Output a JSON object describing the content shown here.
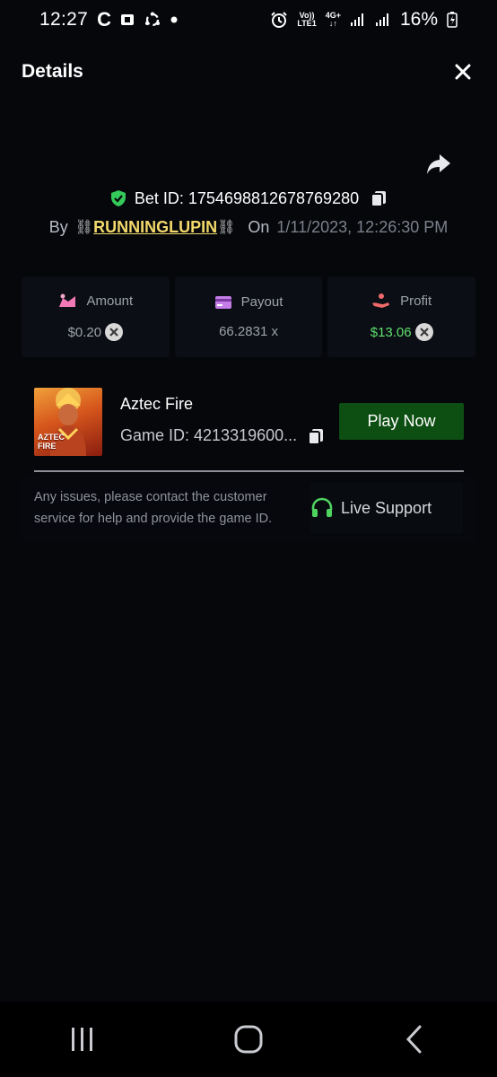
{
  "status_bar": {
    "time": "12:27",
    "carrier_icon": "C",
    "volte_top": "Vo))",
    "volte_bottom": "LTE1",
    "network_top": "4G+",
    "network_bottom": "↓↑",
    "battery_percent": "16%"
  },
  "header": {
    "title": "Details",
    "close_icon": "close-icon"
  },
  "bet": {
    "bet_id_label": "Bet ID: 1754698812678769280",
    "by_label": "By",
    "chain_left": "⛓",
    "username": "RUNNINGLUPIN",
    "chain_right": "⛓",
    "on_label": "On",
    "datetime": "1/11/2023, 12:26:30 PM"
  },
  "stats": {
    "amount": {
      "label": "Amount",
      "value": "$0.20"
    },
    "payout": {
      "label": "Payout",
      "value": "66.2831 x"
    },
    "profit": {
      "label": "Profit",
      "value": "$13.06"
    }
  },
  "game": {
    "thumb_line1": "AZTEC",
    "thumb_line2": "FIRE",
    "name": "Aztec Fire",
    "game_id": "Game ID: 4213319600...",
    "play_button": "Play Now"
  },
  "support": {
    "text": "Any issues, please contact the customer service for help and provide the game ID.",
    "live_support": "Live Support"
  },
  "colors": {
    "background": "#05070b",
    "accent_green": "#5fe06f",
    "play_button": "#0d4e12",
    "username": "#f3d96b"
  }
}
